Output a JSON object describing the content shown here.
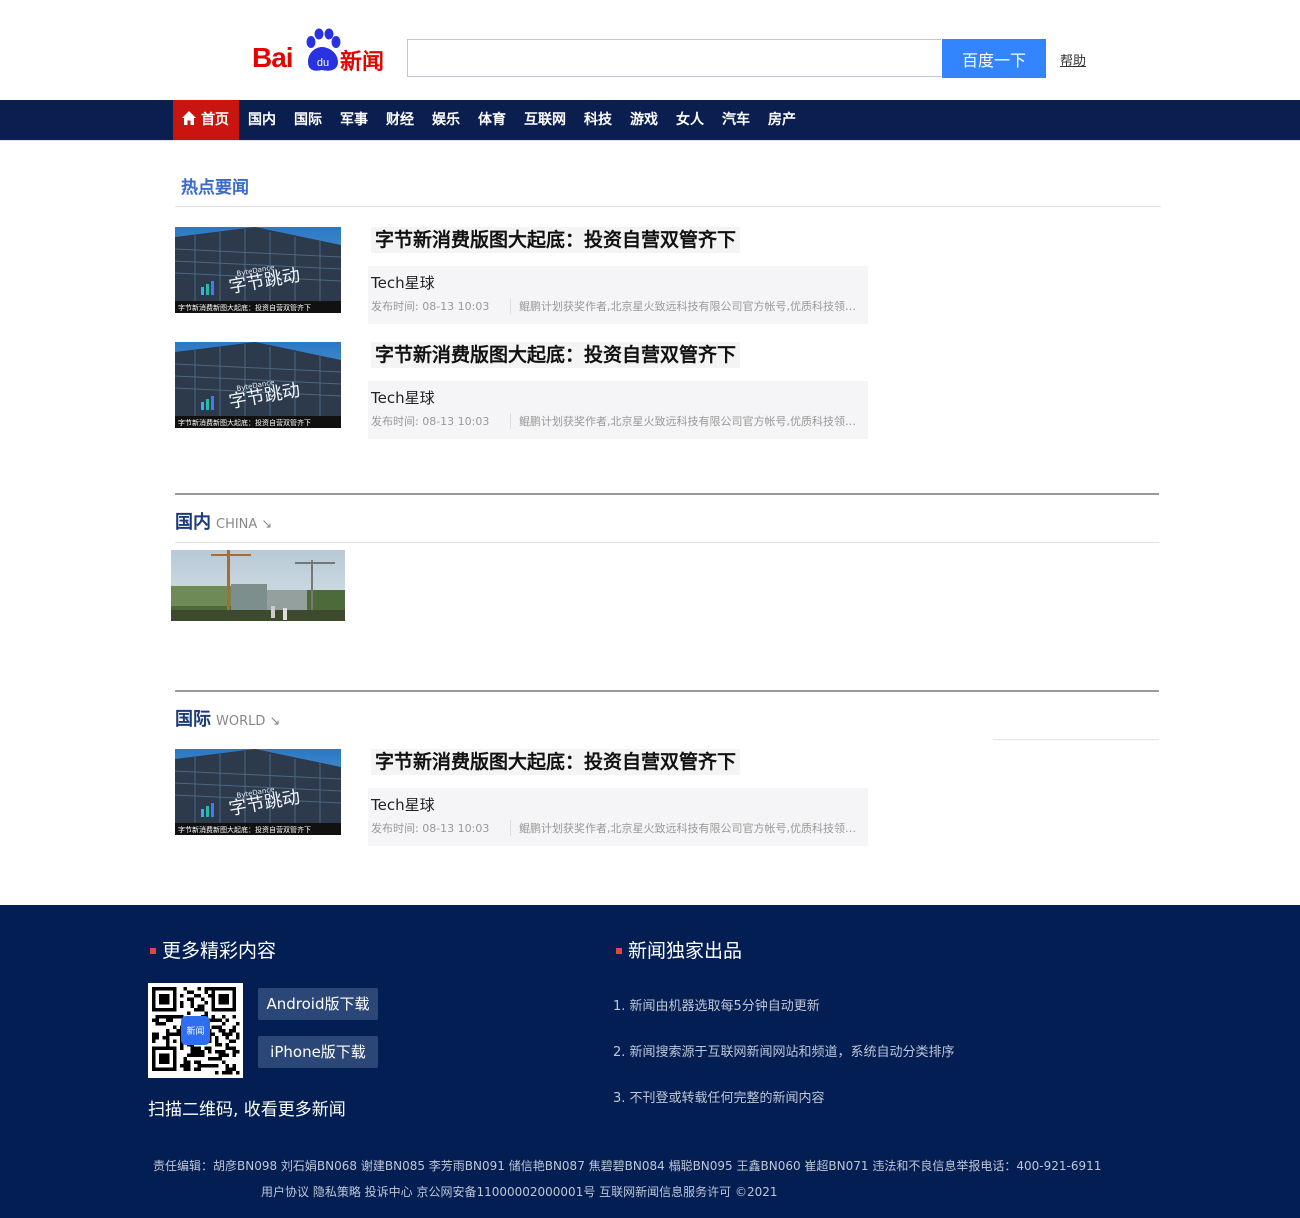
{
  "header": {
    "logo_bai": "Bai",
    "logo_du": "du",
    "logo_news": "新闻",
    "search_placeholder": "",
    "search_button": "百度一下",
    "help": "帮助"
  },
  "nav": {
    "items": [
      "首页",
      "国内",
      "国际",
      "军事",
      "财经",
      "娱乐",
      "体育",
      "互联网",
      "科技",
      "游戏",
      "女人",
      "汽车",
      "房产"
    ],
    "active_index": 0,
    "active_color": "#c9140f",
    "bg_color": "#0a1f4f"
  },
  "hot_news": {
    "title": "热点要闻",
    "items": [
      {
        "headline": "字节新消费版图大起底：投资自营双管齐下",
        "source": "Tech星球",
        "time": "发布时间: 08-13  10:03",
        "desc": "鲲鹏计划获奖作者,北京星火致远科技有限公司官方帐号,优质科技领域创作者",
        "thumb_caption": "字节新消费新图大起底：投资自营双管齐下",
        "thumb_brand": "字节跳动",
        "thumb_brand_en": "ByteDance"
      },
      {
        "headline": "字节新消费版图大起底：投资自营双管齐下",
        "source": "Tech星球",
        "time": "发布时间: 08-13  10:03",
        "desc": "鲲鹏计划获奖作者,北京星火致远科技有限公司官方帐号,优质科技领域创作者",
        "thumb_caption": "字节新消费新图大起底：投资自营双管齐下",
        "thumb_brand": "字节跳动",
        "thumb_brand_en": "ByteDance"
      }
    ]
  },
  "china": {
    "title": "国内",
    "title_en": "CHINA ↘"
  },
  "world": {
    "title": "国际",
    "title_en": "WORLD ↘",
    "items": [
      {
        "headline": "字节新消费版图大起底：投资自营双管齐下",
        "source": "Tech星球",
        "time": "发布时间: 08-13  10:03",
        "desc": "鲲鹏计划获奖作者,北京星火致远科技有限公司官方帐号,优质科技领域创作者",
        "thumb_caption": "字节新消费新图大起底：投资自营双管齐下",
        "thumb_brand": "字节跳动",
        "thumb_brand_en": "ByteDance"
      }
    ]
  },
  "footer": {
    "more_title": "更多精彩内容",
    "exclusive_title": "新闻独家出品",
    "android": "Android版下载",
    "iphone": "iPhone版下载",
    "qr_label": "新闻",
    "scan": "扫描二维码, 收看更多新闻",
    "list": [
      "1. 新闻由机器选取每5分钟自动更新",
      "2. 新闻搜索源于互联网新闻网站和频道，系统自动分类排序",
      "3. 不刊登或转载任何完整的新闻内容"
    ],
    "credit": "责任编辑：胡彦BN098 刘石娟BN068 谢建BN085 李芳雨BN091 储信艳BN087 焦碧碧BN084 榻聪BN095 王鑫BN060 崔超BN071 违法和不良信息举报电话：400-921-6911",
    "links": "用户协议 隐私策略 投诉中心 京公网安备11000002000001号 互联网新闻信息服务许可 ©2021",
    "bg_color": "#021e52"
  }
}
